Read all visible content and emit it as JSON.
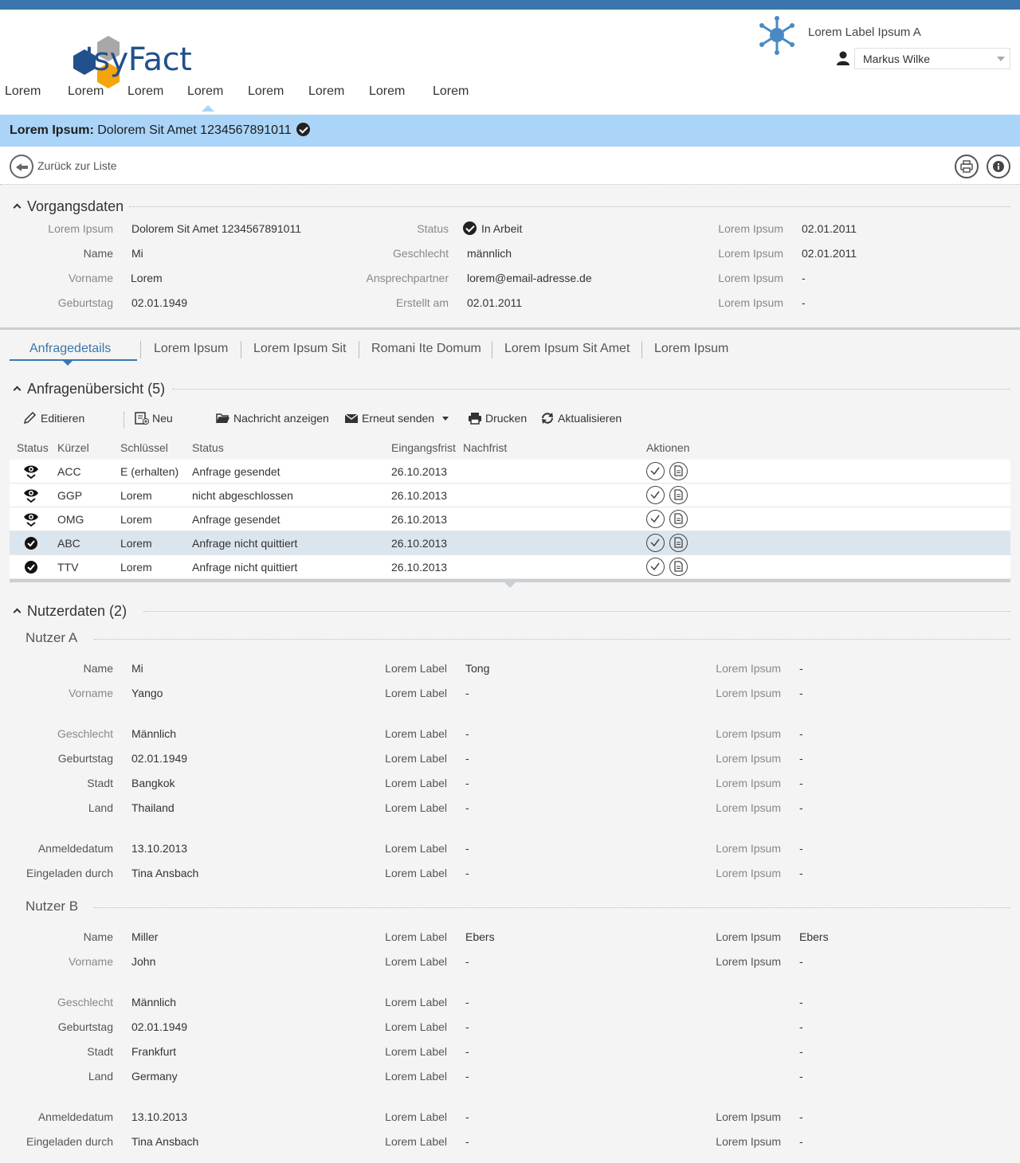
{
  "header": {
    "logo_text": "IsyFact",
    "app_label": "Lorem Label Ipsum A",
    "user": "Markus Wilke"
  },
  "nav": [
    "Lorem",
    "Lorem",
    "Lorem",
    "Lorem",
    "Lorem",
    "Lorem",
    "Lorem",
    "Lorem"
  ],
  "title": {
    "prefix": "Lorem Ipsum:",
    "text": "Dolorem Sit Amet 1234567891011"
  },
  "back_label": "Zurück zur Liste",
  "vorgang": {
    "title": "Vorgangsdaten",
    "col1": [
      {
        "label": "Lorem Ipsum",
        "value": "Dolorem Sit Amet 1234567891011"
      },
      {
        "label": "Name",
        "value": "Mi"
      },
      {
        "label": "Vorname",
        "value": "Lorem"
      },
      {
        "label": "Geburtstag",
        "value": "02.01.1949"
      }
    ],
    "col2": [
      {
        "label": "Status",
        "value": "In Arbeit"
      },
      {
        "label": "Geschlecht",
        "value": "männlich"
      },
      {
        "label": "Ansprechpartner",
        "value": "lorem@email-adresse.de"
      },
      {
        "label": "Erstellt am",
        "value": "02.01.2011"
      }
    ],
    "col3": [
      {
        "label": "Lorem Ipsum",
        "value": "02.01.2011"
      },
      {
        "label": "Lorem Ipsum",
        "value": "02.01.2011"
      },
      {
        "label": "Lorem Ipsum",
        "value": "-"
      },
      {
        "label": "Lorem Ipsum",
        "value": "-"
      }
    ]
  },
  "tabs": [
    "Anfragedetails",
    "Lorem Ipsum",
    "Lorem Ipsum Sit",
    "Romani Ite Domum",
    "Lorem Ipsum Sit Amet",
    "Lorem Ipsum"
  ],
  "anfragen": {
    "title": "Anfragenübersicht (5)",
    "toolbar": {
      "edit": "Editieren",
      "new": "Neu",
      "show_message": "Nachricht anzeigen",
      "resend": "Erneut senden",
      "print": "Drucken",
      "refresh": "Aktualisieren"
    },
    "columns": [
      "Status",
      "Kürzel",
      "Schlüssel",
      "Status",
      "Eingangsfrist",
      "Nachfrist",
      "Aktionen"
    ],
    "rows": [
      {
        "icon": "eye-icon",
        "kuerzel": "ACC",
        "schluessel": "E (erhalten)",
        "status": "Anfrage gesendet",
        "eingangsfrist": "26.10.2013",
        "nachfrist": ""
      },
      {
        "icon": "eye-icon",
        "kuerzel": "GGP",
        "schluessel": "Lorem",
        "status": "nicht abgeschlossen",
        "eingangsfrist": "26.10.2013",
        "nachfrist": ""
      },
      {
        "icon": "eye-icon",
        "kuerzel": "OMG",
        "schluessel": "Lorem",
        "status": "Anfrage gesendet",
        "eingangsfrist": "26.10.2013",
        "nachfrist": ""
      },
      {
        "icon": "check-circle-icon",
        "kuerzel": "ABC",
        "schluessel": "Lorem",
        "status": "Anfrage nicht quittiert",
        "eingangsfrist": "26.10.2013",
        "nachfrist": ""
      },
      {
        "icon": "check-circle-icon",
        "kuerzel": "TTV",
        "schluessel": "Lorem",
        "status": "Anfrage nicht quittiert",
        "eingangsfrist": "26.10.2013",
        "nachfrist": ""
      }
    ]
  },
  "nutzer": {
    "title": "Nutzerdaten (2)",
    "a": {
      "title": "Nutzer A",
      "col1": [
        {
          "label": "Name",
          "value": "Mi"
        },
        {
          "label": "Vorname",
          "value": "Yango"
        },
        {
          "label": "Geschlecht",
          "value": "Männlich"
        },
        {
          "label": "Geburtstag",
          "value": "02.01.1949"
        },
        {
          "label": "Stadt",
          "value": "Bangkok"
        },
        {
          "label": "Land",
          "value": "Thailand"
        },
        {
          "label": "Anmeldedatum",
          "value": "13.10.2013"
        },
        {
          "label": "Eingeladen durch",
          "value": "Tina Ansbach"
        }
      ],
      "col2": [
        {
          "label": "Lorem Label",
          "value": "Tong"
        },
        {
          "label": "Lorem Label",
          "value": "-"
        },
        {
          "label": "Lorem Label",
          "value": "-"
        },
        {
          "label": "Lorem Label",
          "value": "-"
        },
        {
          "label": "Lorem Label",
          "value": "-"
        },
        {
          "label": "Lorem Label",
          "value": "-"
        },
        {
          "label": "Lorem Label",
          "value": "-"
        },
        {
          "label": "Lorem Label",
          "value": "-"
        }
      ],
      "col3": [
        {
          "label": "Lorem Ipsum",
          "value": "-"
        },
        {
          "label": "Lorem Ipsum",
          "value": "-"
        },
        {
          "label": "Lorem Ipsum",
          "value": "-"
        },
        {
          "label": "Lorem Ipsum",
          "value": "-"
        },
        {
          "label": "Lorem Ipsum",
          "value": "-"
        },
        {
          "label": "Lorem Ipsum",
          "value": "-"
        },
        {
          "label": "Lorem Ipsum",
          "value": "-"
        },
        {
          "label": "Lorem Ipsum",
          "value": "-"
        }
      ]
    },
    "b": {
      "title": "Nutzer B",
      "col1": [
        {
          "label": "Name",
          "value": "Miller"
        },
        {
          "label": "Vorname",
          "value": "John"
        },
        {
          "label": "Geschlecht",
          "value": "Männlich"
        },
        {
          "label": "Geburtstag",
          "value": "02.01.1949"
        },
        {
          "label": "Stadt",
          "value": "Frankfurt"
        },
        {
          "label": "Land",
          "value": "Germany"
        },
        {
          "label": "Anmeldedatum",
          "value": "13.10.2013"
        },
        {
          "label": "Eingeladen durch",
          "value": "Tina Ansbach"
        }
      ],
      "col2": [
        {
          "label": "Lorem Label",
          "value": "Ebers"
        },
        {
          "label": "Lorem Label",
          "value": "-"
        },
        {
          "label": "Lorem Label",
          "value": "-"
        },
        {
          "label": "Lorem Label",
          "value": "-"
        },
        {
          "label": "Lorem Label",
          "value": "-"
        },
        {
          "label": "Lorem Label",
          "value": "-"
        },
        {
          "label": "Lorem Label",
          "value": "-"
        },
        {
          "label": "Lorem Label",
          "value": "-"
        }
      ],
      "col3": [
        {
          "label": "Lorem Ipsum",
          "value": "Ebers"
        },
        {
          "label": "Lorem Ipsum",
          "value": "-"
        },
        {
          "label": "",
          "value": "-"
        },
        {
          "label": "",
          "value": "-"
        },
        {
          "label": "",
          "value": "-"
        },
        {
          "label": "",
          "value": "-"
        },
        {
          "label": "Lorem Ipsum",
          "value": "-"
        },
        {
          "label": "Lorem Ipsum",
          "value": "-"
        }
      ]
    }
  }
}
